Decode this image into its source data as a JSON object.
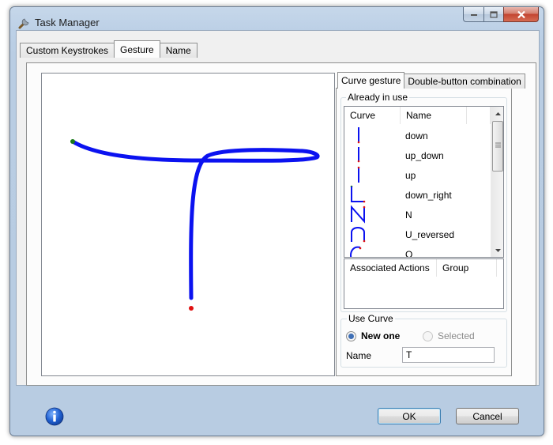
{
  "window": {
    "title": "Task Manager"
  },
  "main_tabs": [
    {
      "label": "Custom Keystrokes",
      "active": false
    },
    {
      "label": "Gesture",
      "active": true
    },
    {
      "label": "Name",
      "active": false
    }
  ],
  "right_tabs": [
    {
      "label": "Curve gesture",
      "active": true
    },
    {
      "label": "Double-button combination",
      "active": false
    }
  ],
  "already_in_use": {
    "label": "Already in use",
    "columns": [
      "Curve",
      "Name"
    ],
    "rows": [
      "down",
      "up_down",
      "up",
      "down_right",
      "N",
      "U_reversed",
      "O"
    ]
  },
  "actions": {
    "columns": [
      "Associated Actions",
      "Group"
    ]
  },
  "use_curve": {
    "label": "Use Curve",
    "new_one": "New one",
    "selected": "Selected",
    "selected_option": "New one",
    "name_label": "Name",
    "name_value": "T"
  },
  "buttons": {
    "ok": "OK",
    "cancel": "Cancel"
  },
  "colors": {
    "stroke": "#0b12f0",
    "start_point": "#1a7a1a",
    "end_point": "#e01010"
  },
  "icons": {
    "app": "wrench-icon",
    "info": "info-icon",
    "minimize": "minimize-icon",
    "maximize": "maximize-icon",
    "close": "close-icon"
  }
}
